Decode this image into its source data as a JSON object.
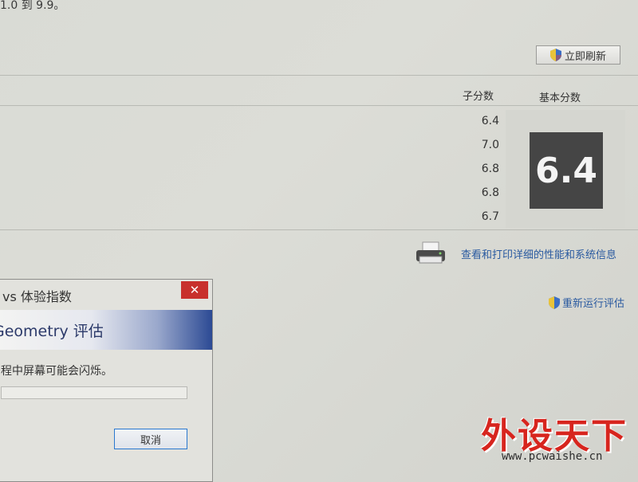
{
  "page": {
    "top_text": "1.0 到 9.9。",
    "refresh_button": "立即刷新",
    "headers": {
      "sub_score": "子分数",
      "base_score": "基本分数"
    },
    "sub_scores": [
      "6.4",
      "7.0",
      "6.8",
      "6.8",
      "6.7"
    ],
    "base_score": "6.4",
    "print_link": "查看和打印详细的性能和系统信息",
    "rerun_link": "重新运行评估"
  },
  "dialog": {
    "title": "vs 体验指数",
    "close_label": "✕",
    "heading": "Geometry 评估",
    "message": "程中屏幕可能会闪烁。",
    "progress": 0,
    "cancel_button": "取消"
  },
  "watermark": {
    "main": "外设天下",
    "url": "www.pcwaishe.cn"
  },
  "colors": {
    "link": "#2a5aa0",
    "score_box": "#454545",
    "close": "#c8302c",
    "watermark": "#d7251e"
  }
}
